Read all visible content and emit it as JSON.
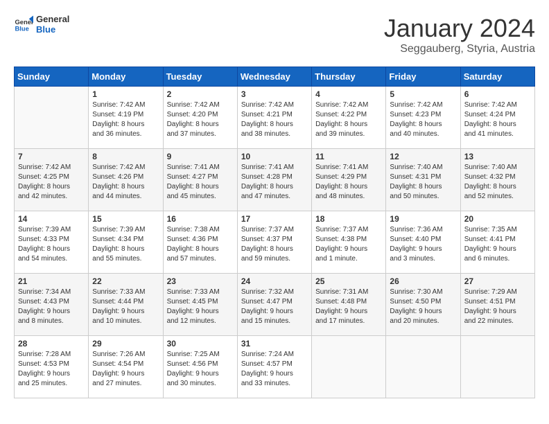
{
  "logo": {
    "line1": "General",
    "line2": "Blue"
  },
  "title": "January 2024",
  "location": "Seggauberg, Styria, Austria",
  "days_of_week": [
    "Sunday",
    "Monday",
    "Tuesday",
    "Wednesday",
    "Thursday",
    "Friday",
    "Saturday"
  ],
  "weeks": [
    [
      {
        "day": "",
        "content": ""
      },
      {
        "day": "1",
        "content": "Sunrise: 7:42 AM\nSunset: 4:19 PM\nDaylight: 8 hours\nand 36 minutes."
      },
      {
        "day": "2",
        "content": "Sunrise: 7:42 AM\nSunset: 4:20 PM\nDaylight: 8 hours\nand 37 minutes."
      },
      {
        "day": "3",
        "content": "Sunrise: 7:42 AM\nSunset: 4:21 PM\nDaylight: 8 hours\nand 38 minutes."
      },
      {
        "day": "4",
        "content": "Sunrise: 7:42 AM\nSunset: 4:22 PM\nDaylight: 8 hours\nand 39 minutes."
      },
      {
        "day": "5",
        "content": "Sunrise: 7:42 AM\nSunset: 4:23 PM\nDaylight: 8 hours\nand 40 minutes."
      },
      {
        "day": "6",
        "content": "Sunrise: 7:42 AM\nSunset: 4:24 PM\nDaylight: 8 hours\nand 41 minutes."
      }
    ],
    [
      {
        "day": "7",
        "content": "Sunrise: 7:42 AM\nSunset: 4:25 PM\nDaylight: 8 hours\nand 42 minutes."
      },
      {
        "day": "8",
        "content": "Sunrise: 7:42 AM\nSunset: 4:26 PM\nDaylight: 8 hours\nand 44 minutes."
      },
      {
        "day": "9",
        "content": "Sunrise: 7:41 AM\nSunset: 4:27 PM\nDaylight: 8 hours\nand 45 minutes."
      },
      {
        "day": "10",
        "content": "Sunrise: 7:41 AM\nSunset: 4:28 PM\nDaylight: 8 hours\nand 47 minutes."
      },
      {
        "day": "11",
        "content": "Sunrise: 7:41 AM\nSunset: 4:29 PM\nDaylight: 8 hours\nand 48 minutes."
      },
      {
        "day": "12",
        "content": "Sunrise: 7:40 AM\nSunset: 4:31 PM\nDaylight: 8 hours\nand 50 minutes."
      },
      {
        "day": "13",
        "content": "Sunrise: 7:40 AM\nSunset: 4:32 PM\nDaylight: 8 hours\nand 52 minutes."
      }
    ],
    [
      {
        "day": "14",
        "content": "Sunrise: 7:39 AM\nSunset: 4:33 PM\nDaylight: 8 hours\nand 54 minutes."
      },
      {
        "day": "15",
        "content": "Sunrise: 7:39 AM\nSunset: 4:34 PM\nDaylight: 8 hours\nand 55 minutes."
      },
      {
        "day": "16",
        "content": "Sunrise: 7:38 AM\nSunset: 4:36 PM\nDaylight: 8 hours\nand 57 minutes."
      },
      {
        "day": "17",
        "content": "Sunrise: 7:37 AM\nSunset: 4:37 PM\nDaylight: 8 hours\nand 59 minutes."
      },
      {
        "day": "18",
        "content": "Sunrise: 7:37 AM\nSunset: 4:38 PM\nDaylight: 9 hours\nand 1 minute."
      },
      {
        "day": "19",
        "content": "Sunrise: 7:36 AM\nSunset: 4:40 PM\nDaylight: 9 hours\nand 3 minutes."
      },
      {
        "day": "20",
        "content": "Sunrise: 7:35 AM\nSunset: 4:41 PM\nDaylight: 9 hours\nand 6 minutes."
      }
    ],
    [
      {
        "day": "21",
        "content": "Sunrise: 7:34 AM\nSunset: 4:43 PM\nDaylight: 9 hours\nand 8 minutes."
      },
      {
        "day": "22",
        "content": "Sunrise: 7:33 AM\nSunset: 4:44 PM\nDaylight: 9 hours\nand 10 minutes."
      },
      {
        "day": "23",
        "content": "Sunrise: 7:33 AM\nSunset: 4:45 PM\nDaylight: 9 hours\nand 12 minutes."
      },
      {
        "day": "24",
        "content": "Sunrise: 7:32 AM\nSunset: 4:47 PM\nDaylight: 9 hours\nand 15 minutes."
      },
      {
        "day": "25",
        "content": "Sunrise: 7:31 AM\nSunset: 4:48 PM\nDaylight: 9 hours\nand 17 minutes."
      },
      {
        "day": "26",
        "content": "Sunrise: 7:30 AM\nSunset: 4:50 PM\nDaylight: 9 hours\nand 20 minutes."
      },
      {
        "day": "27",
        "content": "Sunrise: 7:29 AM\nSunset: 4:51 PM\nDaylight: 9 hours\nand 22 minutes."
      }
    ],
    [
      {
        "day": "28",
        "content": "Sunrise: 7:28 AM\nSunset: 4:53 PM\nDaylight: 9 hours\nand 25 minutes."
      },
      {
        "day": "29",
        "content": "Sunrise: 7:26 AM\nSunset: 4:54 PM\nDaylight: 9 hours\nand 27 minutes."
      },
      {
        "day": "30",
        "content": "Sunrise: 7:25 AM\nSunset: 4:56 PM\nDaylight: 9 hours\nand 30 minutes."
      },
      {
        "day": "31",
        "content": "Sunrise: 7:24 AM\nSunset: 4:57 PM\nDaylight: 9 hours\nand 33 minutes."
      },
      {
        "day": "",
        "content": ""
      },
      {
        "day": "",
        "content": ""
      },
      {
        "day": "",
        "content": ""
      }
    ]
  ]
}
